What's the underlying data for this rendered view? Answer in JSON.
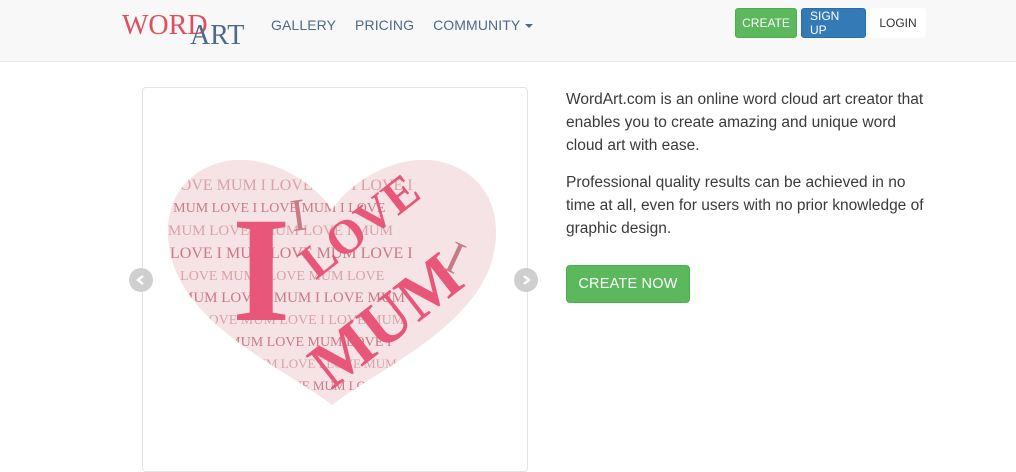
{
  "brand": {
    "logo_text_word": "WORD",
    "logo_text_art": "ART",
    "logo_word_color": "#e04e5e",
    "logo_art_color": "#4d6a8a"
  },
  "nav": {
    "links": [
      {
        "label": "GALLERY"
      },
      {
        "label": "PRICING"
      },
      {
        "label": "COMMUNITY"
      }
    ],
    "create_label": "CREATE",
    "signup_label": "SIGN UP",
    "login_label": "LOGIN"
  },
  "carousel": {
    "slide_words_big": [
      "I",
      "LOVE",
      "MUM"
    ],
    "filler_words": [
      "LOVE",
      "MUM",
      "I"
    ],
    "colors": {
      "primary": "#e8577a",
      "secondary": "#c97a85",
      "muted": "#d9a1a8"
    }
  },
  "intro": {
    "paragraph1": "WordArt.com is an online word cloud art creator that enables you to create amazing and unique word cloud art with ease.",
    "paragraph2": "Professional quality results can be achieved in no time at all, even for users with no prior knowledge of graphic design.",
    "cta_label": "CREATE NOW"
  },
  "colors": {
    "green": "#5cb85c",
    "blue": "#337ab7",
    "navbar_bg": "#f8f8f8"
  }
}
